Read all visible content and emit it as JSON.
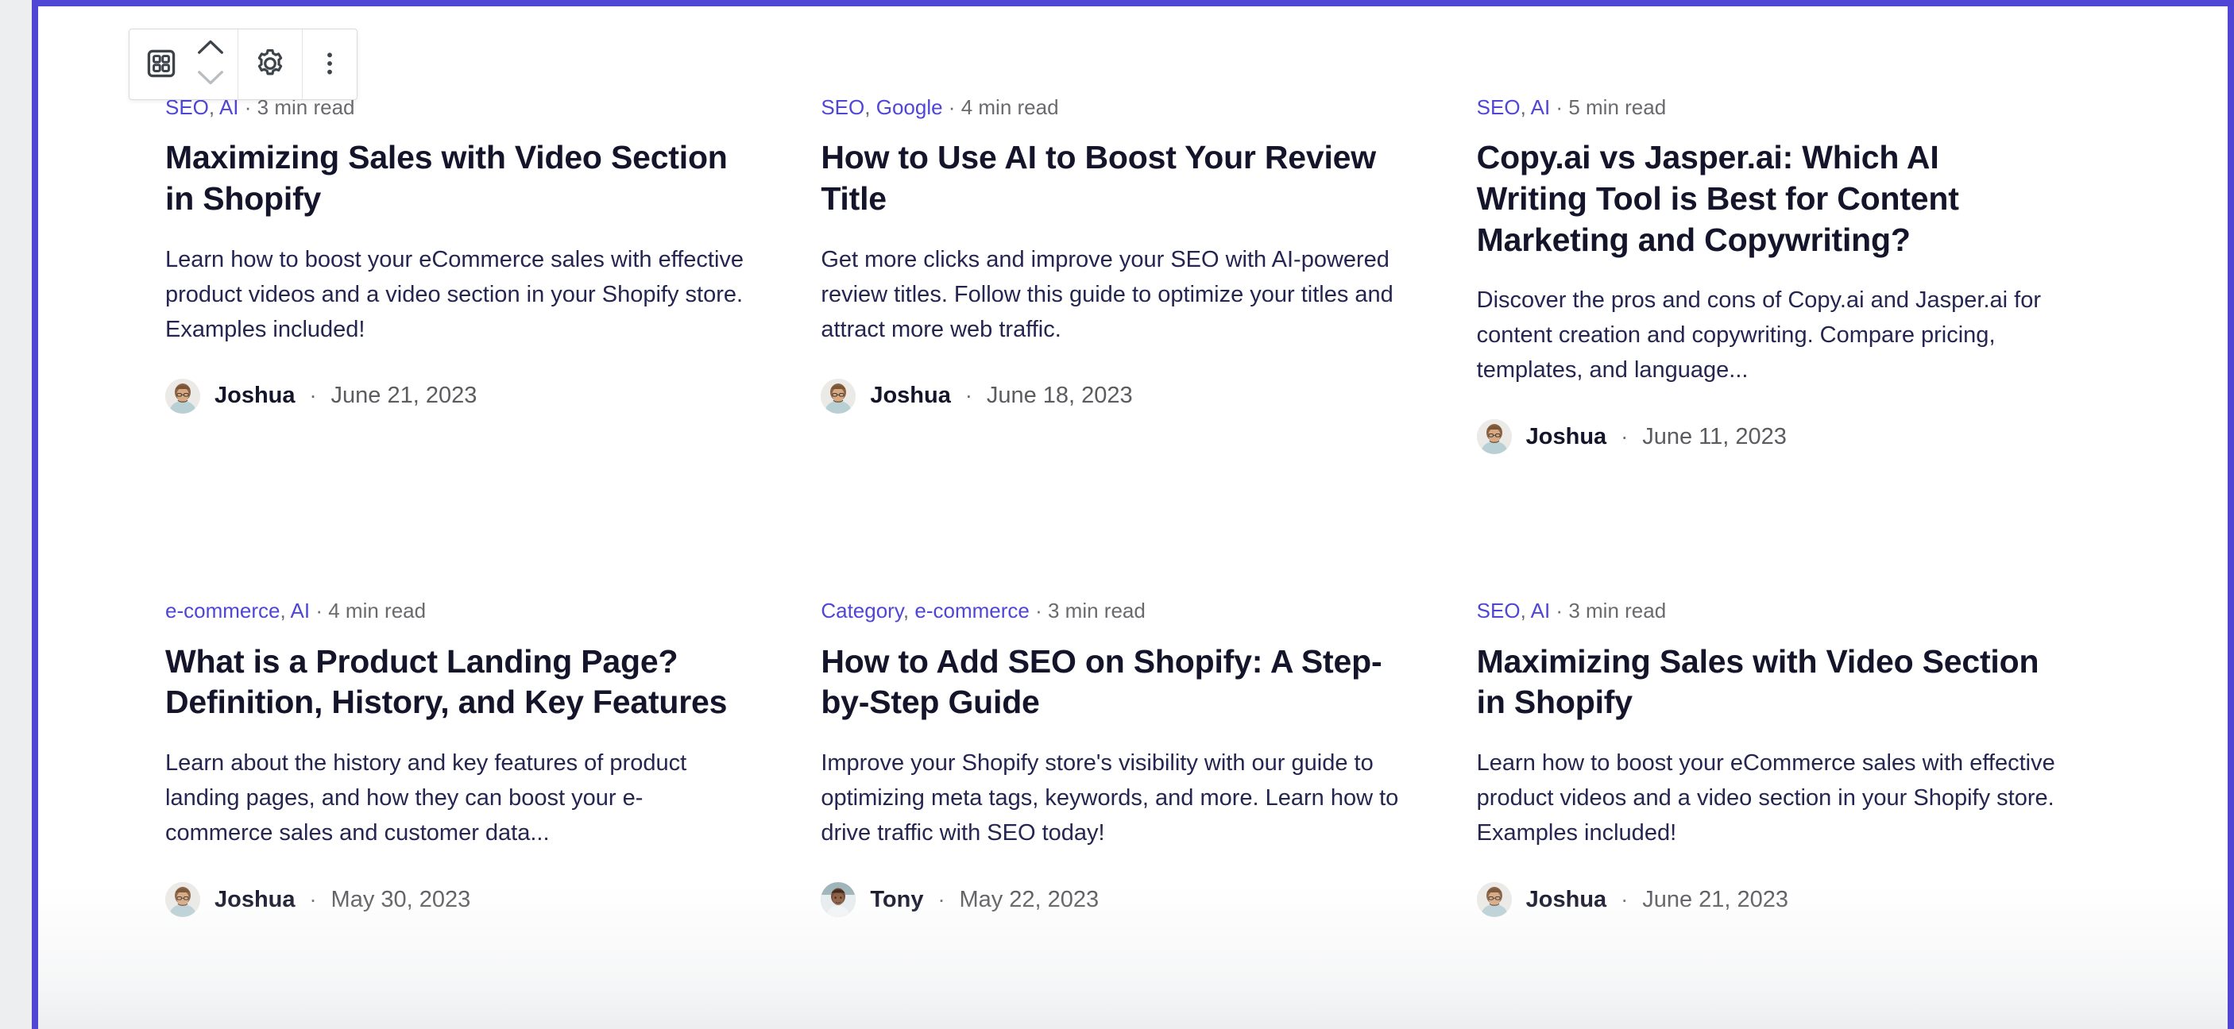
{
  "theme": {
    "selection_color": "#5046d6",
    "link_color": "#5046d6",
    "title_color": "#14142b",
    "body_color": "#252551",
    "muted_color": "#6a6a6e",
    "canvas_background": "#ffffff",
    "app_background": "#eceef0"
  },
  "toolbar": {
    "block_type_label": "Grid",
    "block_type_icon": "grid-blocks-icon",
    "move_up_label": "Move up",
    "move_up_icon": "chevron-up-icon",
    "move_down_label": "Move down",
    "move_down_icon": "chevron-down-icon",
    "settings_label": "Settings",
    "settings_icon": "gear-icon",
    "options_label": "Options",
    "options_icon": "three-dots-vertical-icon"
  },
  "posts": [
    {
      "tags": [
        "SEO",
        "AI"
      ],
      "read_time": "3 min read",
      "separator": "·",
      "title": "Maximizing Sales with Video Section in Shopify",
      "excerpt": "Learn how to boost your eCommerce sales with effective product videos and a video section in your Shopify store. Examples included!",
      "author": "Joshua",
      "author_avatar": "joshua-avatar",
      "date": "June 21, 2023"
    },
    {
      "tags": [
        "SEO",
        "Google"
      ],
      "read_time": "4 min read",
      "separator": "·",
      "title": "How to Use AI to Boost Your Review Title",
      "excerpt": "Get more clicks and improve your SEO with AI-powered review titles. Follow this guide to optimize your titles and attract more web traffic.",
      "author": "Joshua",
      "author_avatar": "joshua-avatar",
      "date": "June 18, 2023"
    },
    {
      "tags": [
        "SEO",
        "AI"
      ],
      "read_time": "5 min read",
      "separator": "·",
      "title": "Copy.ai vs Jasper.ai: Which AI Writing Tool is Best for Content Marketing and Copywriting?",
      "excerpt": "Discover the pros and cons of Copy.ai and Jasper.ai for content creation and copywriting. Compare pricing, templates, and language...",
      "author": "Joshua",
      "author_avatar": "joshua-avatar",
      "date": "June 11, 2023"
    },
    {
      "tags": [
        "e-commerce",
        "AI"
      ],
      "read_time": "4 min read",
      "separator": "·",
      "title": "What is a Product Landing Page? Definition, History, and Key Features",
      "excerpt": "Learn about the history and key features of product landing pages, and how they can boost your e-commerce sales and customer data...",
      "author": "Joshua",
      "author_avatar": "joshua-avatar",
      "date": "May 30, 2023"
    },
    {
      "tags": [
        "Category",
        "e-commerce"
      ],
      "read_time": "3 min read",
      "separator": "·",
      "title": "How to Add SEO on Shopify: A Step-by-Step Guide",
      "excerpt": "Improve your Shopify store's visibility with our guide to optimizing meta tags, keywords, and more. Learn how to drive traffic with SEO today!",
      "author": "Tony",
      "author_avatar": "tony-avatar",
      "date": "May 22, 2023"
    },
    {
      "tags": [
        "SEO",
        "AI"
      ],
      "read_time": "3 min read",
      "separator": "·",
      "title": "Maximizing Sales with Video Section in Shopify",
      "excerpt": "Learn how to boost your eCommerce sales with effective product videos and a video section in your Shopify store. Examples included!",
      "author": "Joshua",
      "author_avatar": "joshua-avatar",
      "date": "June 21, 2023"
    }
  ]
}
